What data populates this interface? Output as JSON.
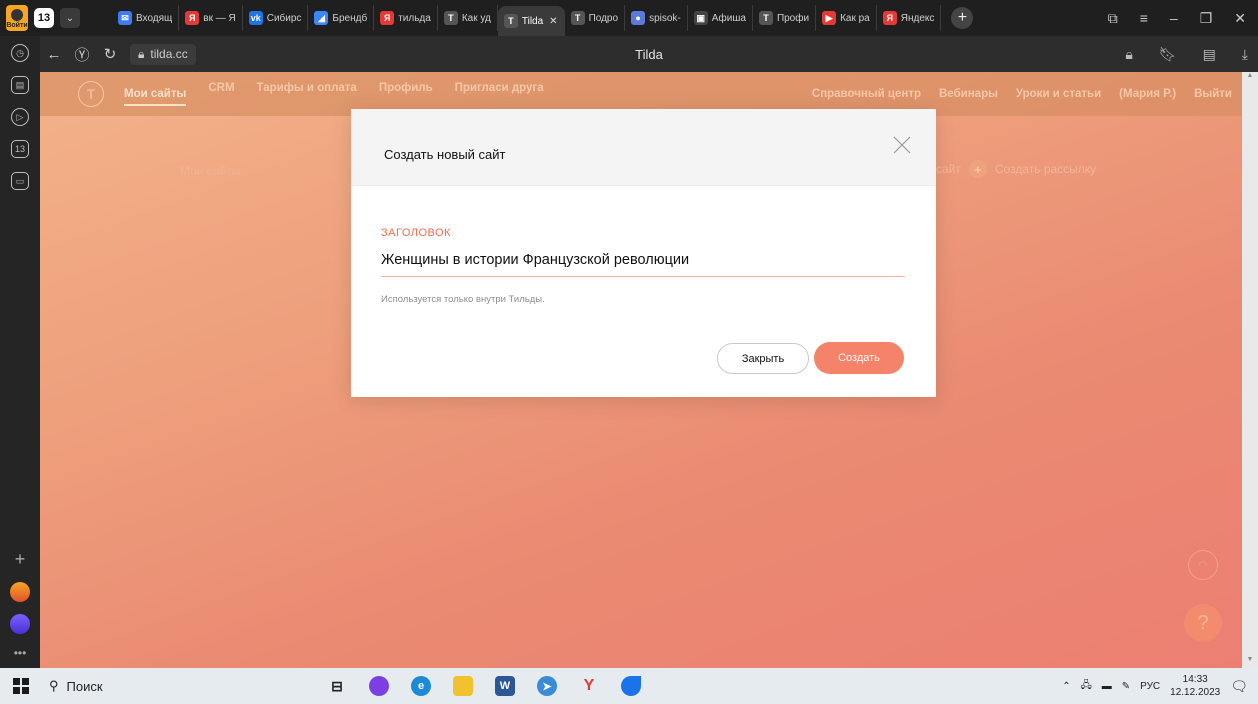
{
  "browser": {
    "tab_count": "13",
    "login_label": "Войти",
    "tabs": [
      {
        "label": "Входящ",
        "color": "#3d7bf5",
        "glyph": "✉"
      },
      {
        "label": "вк — Я",
        "color": "#e53935",
        "glyph": "Я"
      },
      {
        "label": "Сибирс",
        "color": "#1e74e8",
        "glyph": "vk"
      },
      {
        "label": "Брендб",
        "color": "#3a86ff",
        "glyph": "◢"
      },
      {
        "label": "тильда",
        "color": "#e53935",
        "glyph": "Я"
      },
      {
        "label": "Как уд",
        "color": "#555555",
        "glyph": "T"
      },
      {
        "label": "Tilda",
        "color": "#555555",
        "glyph": "T",
        "active": true
      },
      {
        "label": "Подро",
        "color": "#555555",
        "glyph": "T"
      },
      {
        "label": "spisok-",
        "color": "#5b7ad9",
        "glyph": "●"
      },
      {
        "label": "Афиша",
        "color": "#444444",
        "glyph": "▣"
      },
      {
        "label": "Профи",
        "color": "#555555",
        "glyph": "T"
      },
      {
        "label": "Как ра",
        "color": "#e53935",
        "glyph": "▶"
      },
      {
        "label": "Яндекс",
        "color": "#e53935",
        "glyph": "Я"
      }
    ],
    "url": "tilda.cc",
    "page_title": "Tilda"
  },
  "tilda": {
    "nav": [
      "Мои сайты",
      "CRM",
      "Тарифы и оплата",
      "Профиль",
      "Пригласи друга"
    ],
    "nav_right": [
      "Справочный центр",
      "Вебинары",
      "Уроки и статьи",
      "(Мария Р.)",
      "Выйти"
    ],
    "bg_heading": "Мои сайты",
    "bg_action_site": "сайт",
    "bg_action_mail": "Создать рассылку"
  },
  "modal": {
    "title": "Создать новый сайт",
    "field_label": "ЗАГОЛОВОК",
    "field_value": "Женщины в истории Французской революции",
    "hint": "Используется только внутри Тильды.",
    "close_label": "Закрыть",
    "create_label": "Создать"
  },
  "taskbar": {
    "search_label": "Поиск",
    "lang": "РУС",
    "time": "14:33",
    "date": "12.12.2023"
  }
}
